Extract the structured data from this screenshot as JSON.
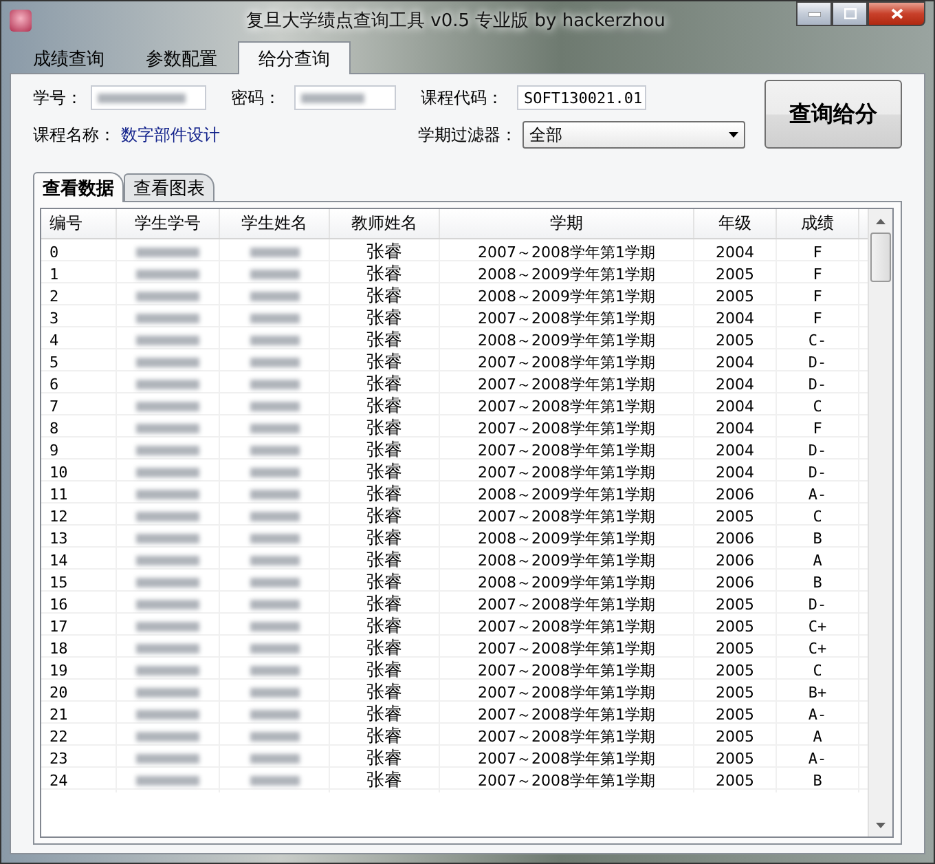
{
  "window": {
    "title": "复旦大学绩点查询工具 v0.5 专业版 by hackerzhou"
  },
  "tabs": [
    {
      "label": "成绩查询",
      "selected": false
    },
    {
      "label": "参数配置",
      "selected": false
    },
    {
      "label": "给分查询",
      "selected": true
    }
  ],
  "form": {
    "student_id_label": "学号：",
    "password_label": "密码：",
    "course_code_label": "课程代码：",
    "course_code_value": "SOFT130021.01",
    "course_name_label": "课程名称：",
    "course_name_value": "数字部件设计",
    "semester_filter_label": "学期过滤器：",
    "semester_filter_value": "全部",
    "query_button": "查询给分"
  },
  "sub_tabs": [
    {
      "label": "查看数据",
      "selected": true
    },
    {
      "label": "查看图表",
      "selected": false
    }
  ],
  "table": {
    "columns": [
      "编号",
      "学生学号",
      "学生姓名",
      "教师姓名",
      "学期",
      "年级",
      "成绩"
    ],
    "rows": [
      {
        "index": "0",
        "teacher": "张睿",
        "semester": "2007～2008学年第1学期",
        "year": "2004",
        "grade": "F"
      },
      {
        "index": "1",
        "teacher": "张睿",
        "semester": "2008～2009学年第1学期",
        "year": "2005",
        "grade": "F"
      },
      {
        "index": "2",
        "teacher": "张睿",
        "semester": "2008～2009学年第1学期",
        "year": "2005",
        "grade": "F"
      },
      {
        "index": "3",
        "teacher": "张睿",
        "semester": "2007～2008学年第1学期",
        "year": "2004",
        "grade": "F"
      },
      {
        "index": "4",
        "teacher": "张睿",
        "semester": "2008～2009学年第1学期",
        "year": "2005",
        "grade": "C-"
      },
      {
        "index": "5",
        "teacher": "张睿",
        "semester": "2007～2008学年第1学期",
        "year": "2004",
        "grade": "D-"
      },
      {
        "index": "6",
        "teacher": "张睿",
        "semester": "2007～2008学年第1学期",
        "year": "2004",
        "grade": "D-"
      },
      {
        "index": "7",
        "teacher": "张睿",
        "semester": "2007～2008学年第1学期",
        "year": "2004",
        "grade": "C"
      },
      {
        "index": "8",
        "teacher": "张睿",
        "semester": "2007～2008学年第1学期",
        "year": "2004",
        "grade": "F"
      },
      {
        "index": "9",
        "teacher": "张睿",
        "semester": "2007～2008学年第1学期",
        "year": "2004",
        "grade": "D-"
      },
      {
        "index": "10",
        "teacher": "张睿",
        "semester": "2007～2008学年第1学期",
        "year": "2004",
        "grade": "D-"
      },
      {
        "index": "11",
        "teacher": "张睿",
        "semester": "2008～2009学年第1学期",
        "year": "2006",
        "grade": "A-"
      },
      {
        "index": "12",
        "teacher": "张睿",
        "semester": "2007～2008学年第1学期",
        "year": "2005",
        "grade": "C"
      },
      {
        "index": "13",
        "teacher": "张睿",
        "semester": "2008～2009学年第1学期",
        "year": "2006",
        "grade": "B"
      },
      {
        "index": "14",
        "teacher": "张睿",
        "semester": "2008～2009学年第1学期",
        "year": "2006",
        "grade": "A"
      },
      {
        "index": "15",
        "teacher": "张睿",
        "semester": "2008～2009学年第1学期",
        "year": "2006",
        "grade": "B"
      },
      {
        "index": "16",
        "teacher": "张睿",
        "semester": "2007～2008学年第1学期",
        "year": "2005",
        "grade": "D-"
      },
      {
        "index": "17",
        "teacher": "张睿",
        "semester": "2007～2008学年第1学期",
        "year": "2005",
        "grade": "C+"
      },
      {
        "index": "18",
        "teacher": "张睿",
        "semester": "2007～2008学年第1学期",
        "year": "2005",
        "grade": "C+"
      },
      {
        "index": "19",
        "teacher": "张睿",
        "semester": "2007～2008学年第1学期",
        "year": "2005",
        "grade": "C"
      },
      {
        "index": "20",
        "teacher": "张睿",
        "semester": "2007～2008学年第1学期",
        "year": "2005",
        "grade": "B+"
      },
      {
        "index": "21",
        "teacher": "张睿",
        "semester": "2007～2008学年第1学期",
        "year": "2005",
        "grade": "A-"
      },
      {
        "index": "22",
        "teacher": "张睿",
        "semester": "2007～2008学年第1学期",
        "year": "2005",
        "grade": "A"
      },
      {
        "index": "23",
        "teacher": "张睿",
        "semester": "2007～2008学年第1学期",
        "year": "2005",
        "grade": "A-"
      },
      {
        "index": "24",
        "teacher": "张睿",
        "semester": "2007～2008学年第1学期",
        "year": "2005",
        "grade": "B"
      }
    ]
  }
}
